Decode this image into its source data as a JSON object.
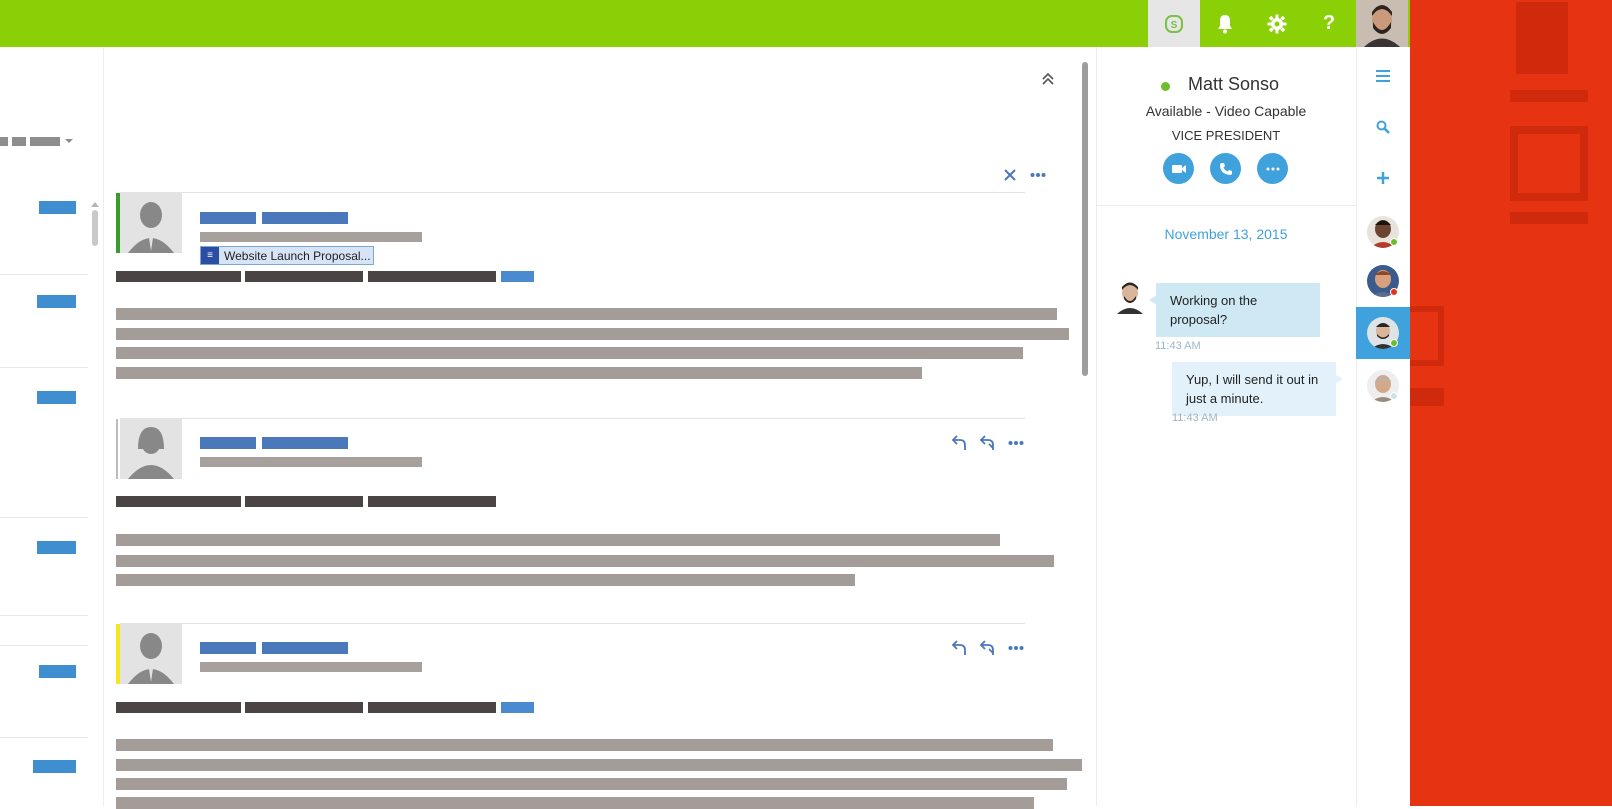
{
  "topbar": {
    "icons": [
      "skype-icon",
      "bell-icon",
      "gear-icon",
      "help-icon"
    ],
    "help_label": "?"
  },
  "colors": {
    "topbar_green": "#8bcf06",
    "accent_blue": "#3fa2dc",
    "brand_red": "#e63312",
    "card_accent_green": "#3a9b2f",
    "card_accent_yellow": "#f4e81d",
    "presence_available": "#6cbf2a",
    "presence_busy": "#e63312"
  },
  "email": {
    "attachment_label": "Website Launch Proposal..."
  },
  "contact": {
    "name": "Matt Sonso",
    "status": "Available - Video Capable",
    "title": "VICE PRESIDENT",
    "actions": [
      "video-icon",
      "phone-icon",
      "more-icon"
    ]
  },
  "conversation": {
    "date": "November 13, 2015",
    "messages": [
      {
        "text": "Working on the proposal?",
        "time": "11:43 AM",
        "from": "contact"
      },
      {
        "text": "Yup, I will send it out in just a minute.",
        "time": "11:43 AM",
        "from": "me"
      }
    ]
  },
  "sidenav": {
    "icons": [
      "menu-icon",
      "search-icon",
      "add-icon"
    ]
  }
}
